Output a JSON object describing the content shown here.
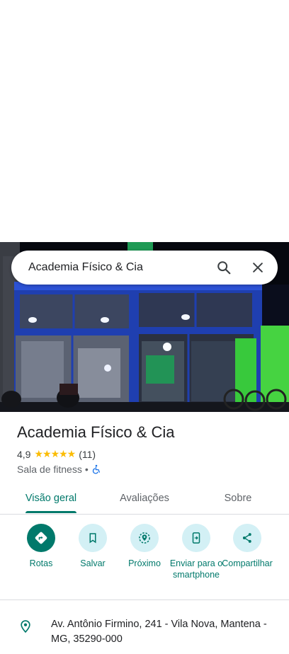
{
  "search": {
    "query": "Academia Físico & Cia",
    "search_icon": "search-icon",
    "close_icon": "close-icon"
  },
  "hero_image": {
    "description_icon": "photo"
  },
  "place": {
    "name": "Academia Físico & Cia",
    "rating": "4,9",
    "stars": "★★★★★",
    "rating_value": 4.9,
    "review_count": "(11)",
    "category": "Sala de fitness",
    "separator": "•",
    "accessibility_icon": "wheelchair-icon"
  },
  "tabs": [
    {
      "label": "Visão geral",
      "active": true
    },
    {
      "label": "Avaliações",
      "active": false
    },
    {
      "label": "Sobre",
      "active": false
    }
  ],
  "actions": [
    {
      "label": "Rotas",
      "icon": "directions-icon"
    },
    {
      "label": "Salvar",
      "icon": "bookmark-icon"
    },
    {
      "label": "Próximo",
      "icon": "nearby-icon"
    },
    {
      "label": "Enviar para o smartphone",
      "icon": "send-to-phone-icon"
    },
    {
      "label": "Compartilhar",
      "icon": "share-icon"
    }
  ],
  "address": {
    "text": "Av. Antônio Firmino, 241 - Vila Nova, Mantena - MG, 35290-000",
    "icon": "location-pin-icon"
  },
  "colors": {
    "accent": "#00796b",
    "chip_bg": "#d3f0f5",
    "star": "#fbbc04",
    "accessibility": "#1a73e8"
  }
}
